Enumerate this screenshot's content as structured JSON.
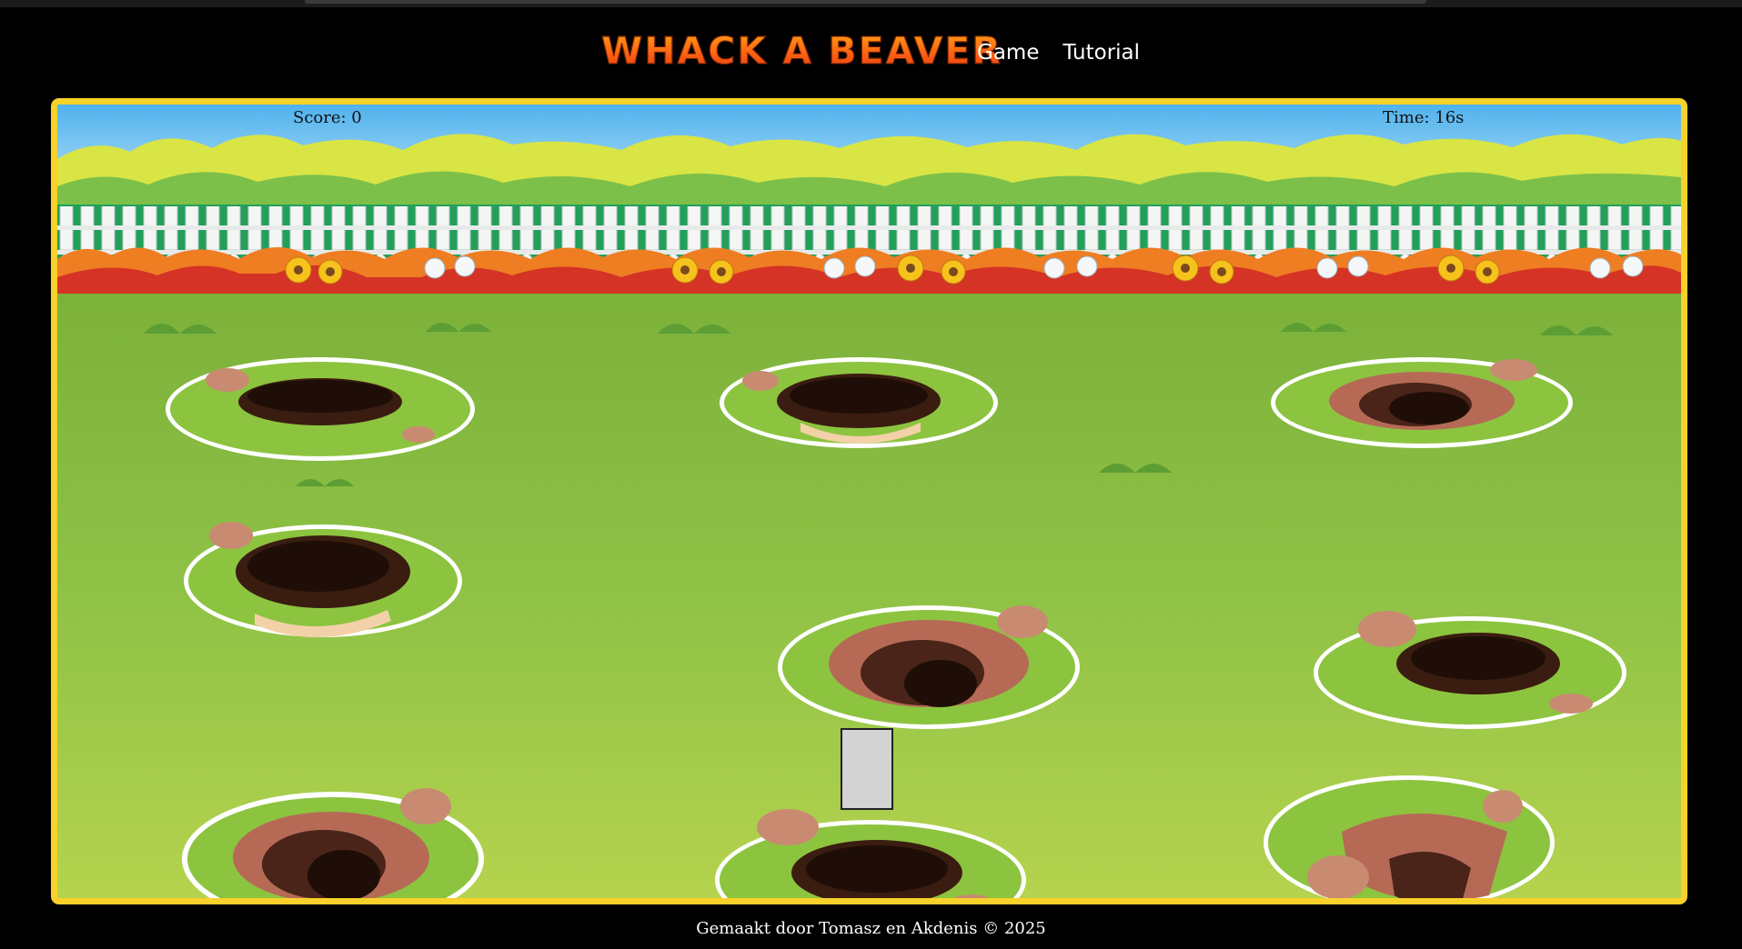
{
  "header": {
    "logo_text": "WHACK A BEAVER",
    "nav": [
      {
        "label": "Game"
      },
      {
        "label": "Tutorial"
      }
    ]
  },
  "game": {
    "score_text": "Score: 0",
    "time_text": "Time: 16s",
    "holes": 9,
    "active_hole": 8
  },
  "colors": {
    "frame_border": "#f8d12a",
    "logo_top": "#ffa515",
    "logo_bottom": "#e23a0c",
    "grass": "#93c244",
    "sky": "#5bb8ec"
  },
  "footer": {
    "text": "Gemaakt door Tomasz en Akdenis © 2025"
  }
}
